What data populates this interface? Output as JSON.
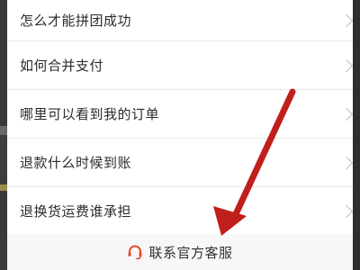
{
  "faq": {
    "items": [
      {
        "label": "怎么才能拼团成功"
      },
      {
        "label": "如何合并支付"
      },
      {
        "label": "哪里可以看到我的订单"
      },
      {
        "label": "退款什么时候到账"
      },
      {
        "label": "退换货运费谁承担"
      }
    ]
  },
  "footer": {
    "label": "联系官方客服",
    "icon": "headset-icon"
  },
  "colors": {
    "accent": "#e64a2e",
    "annotation_arrow": "#c0201c"
  }
}
